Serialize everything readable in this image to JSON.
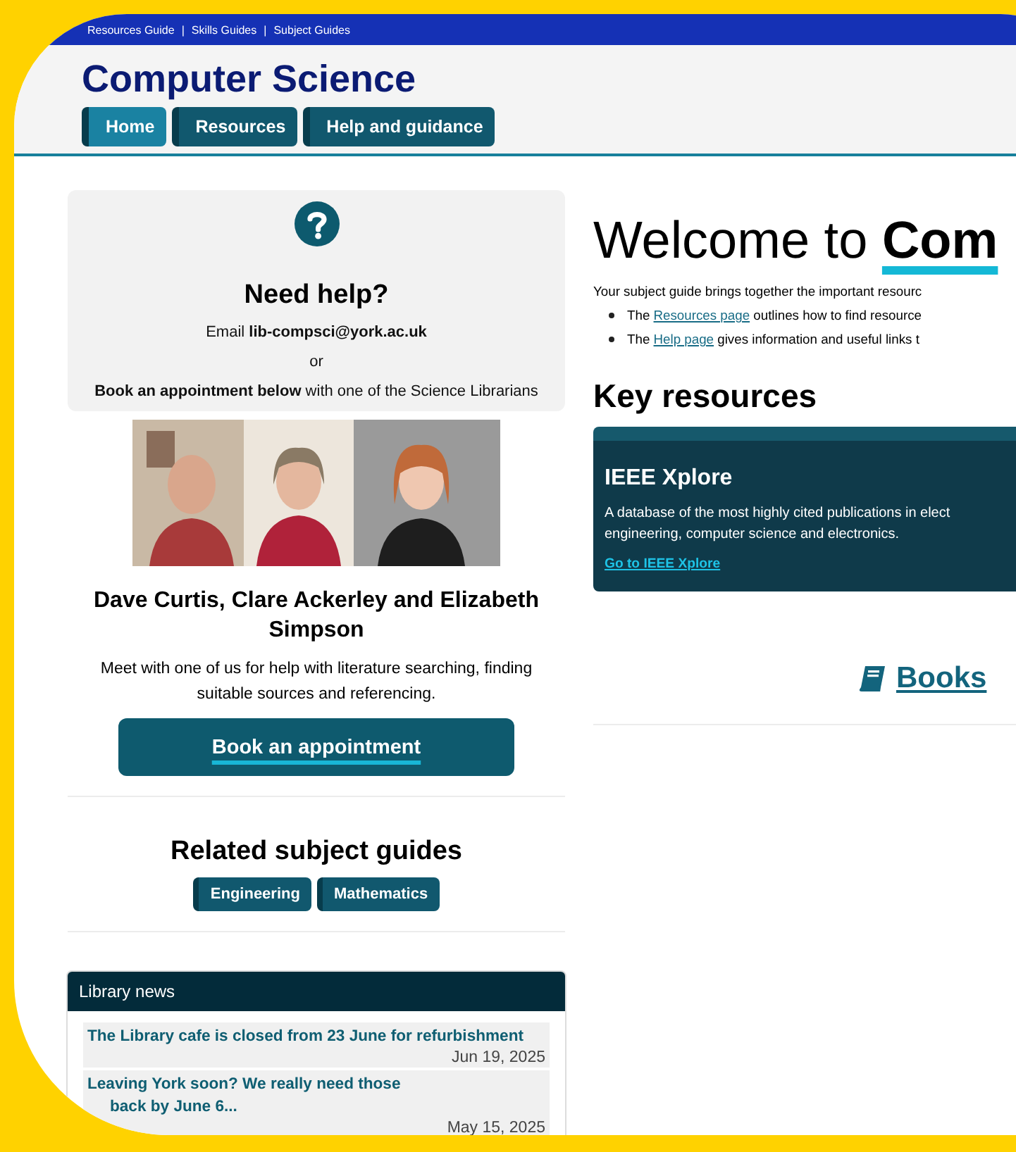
{
  "top_links": [
    "Resources Guide",
    "Skills Guides",
    "Subject Guides"
  ],
  "top_separator": "|",
  "site_title": "Computer Science",
  "nav_tabs": [
    {
      "label": "Home",
      "selected": true
    },
    {
      "label": "Resources",
      "selected": false
    },
    {
      "label": "Help and guidance",
      "selected": false
    }
  ],
  "help_card": {
    "title": "Need help?",
    "email_label": "Email",
    "email": "lib-compsci@york.ac.uk",
    "or": "or",
    "book_text": "**Book an appointment below** with one of the Science Librarians"
  },
  "librarians": {
    "names": "Dave Curtis, Clare Ackerley and Elizabeth Simpson",
    "text": "Meet with one of us for help with literature searching, finding suitable sources and referencing.",
    "button": "Book an appointment"
  },
  "related": {
    "title": "Related subject guides",
    "guides": [
      "Engineering",
      "Mathematics"
    ]
  },
  "news": {
    "title": "Library news",
    "items": [
      {
        "title": "The Library cafe is closed from 23 June for refurbishment",
        "date": "Jun 19, 2025"
      },
      {
        "title": "Leaving York soon? We really need those",
        "continuation": "back by June 6...",
        "date": "May 15, 2025"
      }
    ]
  },
  "welcome": {
    "heading": "Welcome to **Com**",
    "intro": "Your subject guide brings together the important resourc",
    "bullets": [
      {
        "before": "The ",
        "link": "Resources page",
        "after": " outlines how to find resource"
      },
      {
        "before": "The ",
        "link": "Help page",
        "after": " gives information and useful links t"
      }
    ]
  },
  "key_resources": {
    "title": "Key resources",
    "card": {
      "title": "IEEE Xplore",
      "lines": [
        "A database of the most highly cited publications in elect",
        "engineering, computer science and electronics."
      ],
      "link": "Go to IEEE Xplore"
    }
  },
  "books_link": "Books"
}
